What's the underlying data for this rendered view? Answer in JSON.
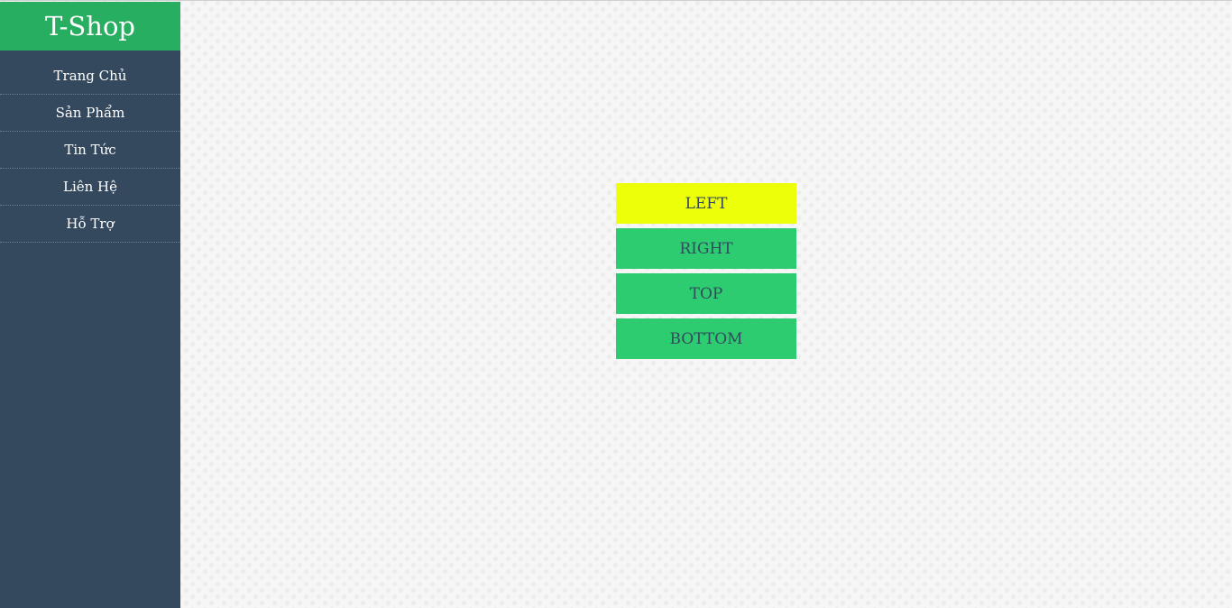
{
  "sidebar": {
    "brand": "T-Shop",
    "items": [
      {
        "label": "Trang Chủ"
      },
      {
        "label": "Sản Phẩm"
      },
      {
        "label": "Tin Tức"
      },
      {
        "label": "Liên Hệ"
      },
      {
        "label": "Hỗ Trợ"
      }
    ]
  },
  "buttons": {
    "left": "LEFT",
    "right": "RIGHT",
    "top": "TOP",
    "bottom": "BOTTOM",
    "active": "left"
  },
  "colors": {
    "sidebar_bg": "#34495e",
    "brand_bg": "#27ae60",
    "button_bg": "#2ecc71",
    "button_active_bg": "#eeff0a",
    "button_text": "#34495e"
  }
}
